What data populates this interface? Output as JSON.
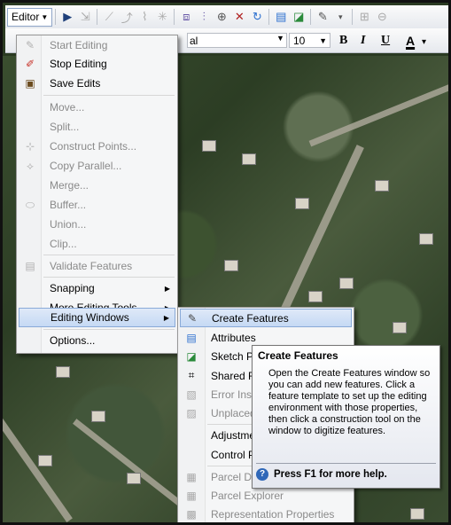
{
  "toolbar": {
    "editor_label": "Editor",
    "font_value": "al",
    "size_value": "10",
    "bold": "B",
    "italic": "I",
    "underline": "U",
    "font_color": "A"
  },
  "menu": {
    "items": [
      {
        "label": "Start Editing",
        "icon": "pencil-icon",
        "disabled": true
      },
      {
        "label": "Stop Editing",
        "icon": "stop-editing-icon",
        "disabled": false
      },
      {
        "label": "Save Edits",
        "icon": "save-icon",
        "disabled": false
      },
      {
        "label": "Move...",
        "disabled": true
      },
      {
        "label": "Split...",
        "disabled": true
      },
      {
        "label": "Construct Points...",
        "icon": "construct-points-icon",
        "disabled": true
      },
      {
        "label": "Copy Parallel...",
        "icon": "copy-parallel-icon",
        "disabled": true
      },
      {
        "label": "Merge...",
        "disabled": true
      },
      {
        "label": "Buffer...",
        "icon": "buffer-icon",
        "disabled": true
      },
      {
        "label": "Union...",
        "disabled": true
      },
      {
        "label": "Clip...",
        "disabled": true
      },
      {
        "label": "Validate Features",
        "icon": "validate-icon",
        "disabled": true
      },
      {
        "label": "Snapping",
        "submenu": true
      },
      {
        "label": "More Editing Tools",
        "submenu": true
      },
      {
        "label": "Editing Windows",
        "submenu": true,
        "highlighted": true
      },
      {
        "label": "Options..."
      }
    ]
  },
  "submenu": {
    "items": [
      {
        "label": "Create Features",
        "icon": "create-features-icon",
        "highlighted": true
      },
      {
        "label": "Attributes",
        "icon": "attributes-icon"
      },
      {
        "label": "Sketch Properties",
        "icon": "sketch-properties-icon"
      },
      {
        "label": "Shared Features",
        "icon": "shared-features-icon"
      },
      {
        "label": "Error Inspector",
        "icon": "error-inspector-icon",
        "disabled": true
      },
      {
        "label": "Unplaced Annotation",
        "icon": "unplaced-annotation-icon",
        "disabled": true
      },
      {
        "label": "Adjustment Preview"
      },
      {
        "label": "Control Points"
      },
      {
        "label": "Parcel Details",
        "icon": "parcel-details-icon",
        "disabled": true
      },
      {
        "label": "Parcel Explorer",
        "icon": "parcel-explorer-icon",
        "disabled": true
      },
      {
        "label": "Representation Properties",
        "icon": "representation-icon",
        "disabled": true
      }
    ]
  },
  "tooltip": {
    "title": "Create Features",
    "body": "Open the Create Features window so you can add new features. Click a feature template to set up the editing environment with those properties, then click a construction tool on the window to digitize features.",
    "help": "Press F1 for more help."
  }
}
